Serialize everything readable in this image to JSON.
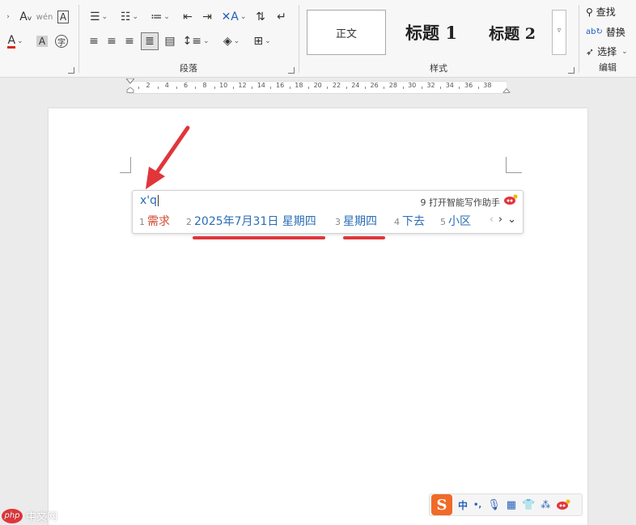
{
  "ribbon": {
    "paragraph_label": "段落",
    "styles_label": "样式",
    "editing_label": "编辑",
    "styles": {
      "normal": "正文",
      "heading1": "标题 1",
      "heading2": "标题 2"
    },
    "editing": {
      "find": "查找",
      "replace": "替换",
      "select": "选择"
    }
  },
  "ruler": {
    "ticks": [
      "2",
      "4",
      "6",
      "8",
      "10",
      "12",
      "14",
      "16",
      "18",
      "20",
      "22",
      "24",
      "26",
      "28",
      "30",
      "32",
      "34",
      "36",
      "38"
    ]
  },
  "ime": {
    "input": "x'q",
    "assist": "9 打开智能写作助手",
    "candidates": [
      {
        "num": "1",
        "text": "需求"
      },
      {
        "num": "2",
        "text": "2025年7月31日 星期四"
      },
      {
        "num": "3",
        "text": "星期四"
      },
      {
        "num": "4",
        "text": "下去"
      },
      {
        "num": "5",
        "text": "小区"
      }
    ]
  },
  "statusbar": {
    "mode": "中",
    "punct": "•,"
  },
  "watermark": {
    "badge": "php",
    "text": "中文网"
  },
  "colors": {
    "accent": "#e0363a",
    "candidate_blue": "#2a6db5",
    "sogou_orange": "#f06a28"
  }
}
